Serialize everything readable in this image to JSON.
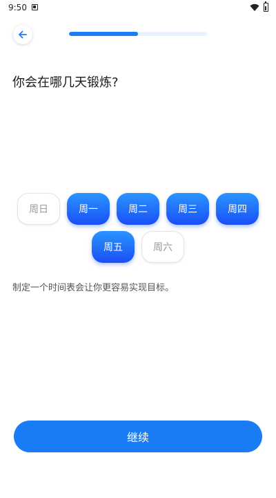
{
  "status_bar": {
    "time": "9:50"
  },
  "progress": {
    "fraction": 0.5
  },
  "question": "你会在哪几天锻炼?",
  "days_row1": [
    {
      "label": "周日",
      "selected": false
    },
    {
      "label": "周一",
      "selected": true
    },
    {
      "label": "周二",
      "selected": true
    },
    {
      "label": "周三",
      "selected": true
    },
    {
      "label": "周四",
      "selected": true
    }
  ],
  "days_row2": [
    {
      "label": "周五",
      "selected": true
    },
    {
      "label": "周六",
      "selected": false
    }
  ],
  "hint": "制定一个时间表会让你更容易实现目标。",
  "continue_label": "继续",
  "colors": {
    "accent": "#1a7cf4",
    "accent_dark": "#1a4ff5",
    "track": "#e8f1ff"
  },
  "icons": {
    "back": "arrow-left-icon",
    "wifi": "wifi-icon",
    "battery": "battery-icon"
  }
}
